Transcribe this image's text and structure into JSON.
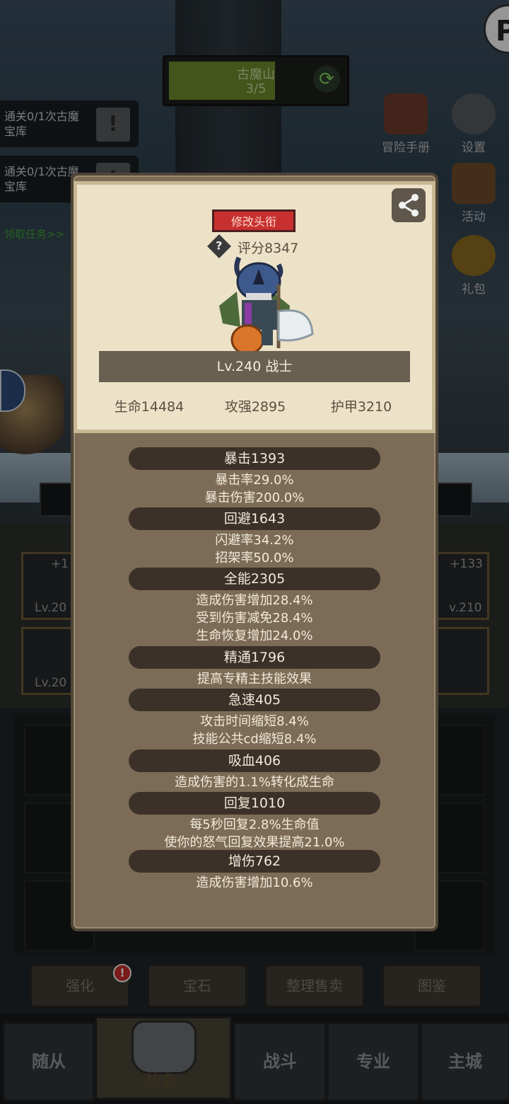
{
  "stage": {
    "name": "古魔山",
    "progress": "3/5",
    "refresh_icon": "refresh-icon"
  },
  "quests": [
    {
      "text": "通关0/1次古魔宝库"
    },
    {
      "text": "通关0/1次古魔宝库"
    }
  ],
  "claim_task": "领取任务>>",
  "pin_badge": "P",
  "side_buttons": {
    "handbook": "冒险手册",
    "settings": "设置",
    "events": "活动",
    "gift": "礼包"
  },
  "equip_slots": [
    {
      "plus": "+1",
      "level": "Lv.20"
    },
    {
      "plus": "",
      "level": "Lv.20"
    },
    {
      "plus": "+133",
      "level": "v.210"
    },
    {
      "plus": "",
      "level": ""
    }
  ],
  "card": {
    "edit_title_button": "修改头衔",
    "score_help": "?",
    "score": "评分8347",
    "level_class": "Lv.240 战士",
    "main_stats": [
      "生命14484",
      "攻强2895",
      "护甲3210"
    ]
  },
  "stats": [
    {
      "header": "暴击1393",
      "lines": [
        "暴击率29.0%",
        "暴击伤害200.0%"
      ]
    },
    {
      "header": "回避1643",
      "lines": [
        "闪避率34.2%",
        "招架率50.0%"
      ]
    },
    {
      "header": "全能2305",
      "lines": [
        "造成伤害增加28.4%",
        "受到伤害减免28.4%",
        "生命恢复增加24.0%"
      ]
    },
    {
      "header": "精通1796",
      "lines": [
        "提高专精主技能效果"
      ]
    },
    {
      "header": "急速405",
      "lines": [
        "攻击时间缩短8.4%",
        "技能公共cd缩短8.4%"
      ]
    },
    {
      "header": "吸血406",
      "lines": [
        "造成伤害的1.1%转化成生命"
      ]
    },
    {
      "header": "回复1010",
      "lines": [
        "每5秒回复2.8%生命值",
        "使你的怒气回复效果提高21.0%"
      ]
    },
    {
      "header": "增伤762",
      "lines": [
        "造成伤害增加10.6%"
      ]
    }
  ],
  "actions": {
    "enhance": "强化",
    "gem": "宝石",
    "sort_sell": "整理售卖",
    "codex": "图鉴",
    "alert": "!"
  },
  "nav": {
    "followers": "随从",
    "equipment": "装备",
    "battle": "战斗",
    "profession": "专业",
    "city": "主城"
  },
  "colors": {
    "panel_bg": "#7c6c57",
    "card_bg": "#ece2c8",
    "title_red": "#c7302f",
    "pill": "#3b3128"
  }
}
